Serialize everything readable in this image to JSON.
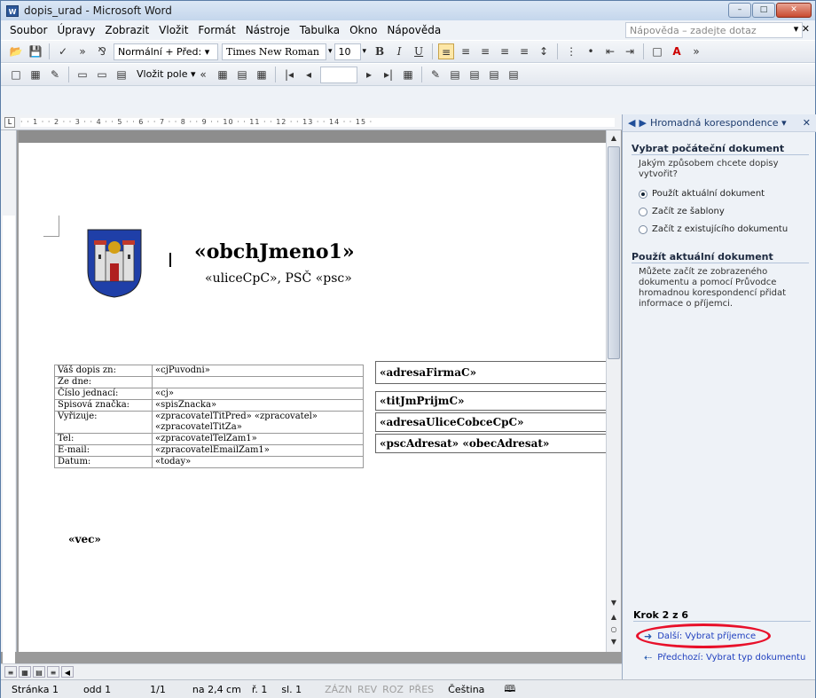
{
  "window": {
    "title": "dopis_urad - Microsoft Word",
    "app_icon": "W",
    "buttons": [
      "–",
      "□",
      "✕"
    ]
  },
  "menu": {
    "items": [
      "Soubor",
      "Úpravy",
      "Zobrazit",
      "Vložit",
      "Formát",
      "Nástroje",
      "Tabulka",
      "Okno",
      "Nápověda"
    ],
    "help_placeholder": "Nápověda – zadejte dotaz",
    "close": "▾ ✕"
  },
  "toolbar1": {
    "style": "Normální + Před: ▾",
    "font": "Times New Roman",
    "font_arrow": "▾",
    "size": "10",
    "size_arrow": "▾",
    "bold": "B",
    "italic": "I",
    "underline": "U"
  },
  "toolbar2": {
    "insert_field": "Vložit pole ▾",
    "nav_first": "|◂",
    "nav_prev": "◂",
    "nav_next": "▸",
    "nav_last": "▸|"
  },
  "document": {
    "company": "«obchJmeno1»",
    "address": "«uliceCpC», PSČ «psc»",
    "info_rows": [
      {
        "k": "Váš dopis zn:",
        "v": "«cjPuvodni»"
      },
      {
        "k": "Ze dne:",
        "v": ""
      },
      {
        "k": "Číslo jednací:",
        "v": "«cj»"
      },
      {
        "k": "Spisová značka:",
        "v": "«spisZnacka»"
      },
      {
        "k": "Vyřizuje:",
        "v": "«zpracovatelTitPred» «zpracovatel»"
      },
      {
        "k": "",
        "v": "«zpracovatelTitZa»"
      },
      {
        "k": "Tel:",
        "v": "«zpracovatelTelZam1»"
      },
      {
        "k": "E-mail:",
        "v": "«zpracovatelEmailZam1»"
      },
      {
        "k": "Datum:",
        "v": "«today»"
      }
    ],
    "recipient": [
      "«adresaFirmaC»",
      "«titJmPrijmC»",
      "«adresaUliceCobceCpC»",
      "«pscAdresat» «obecAdresat»"
    ],
    "subject": "«vec»"
  },
  "ruler": {
    "scale": "· · 1 · · 2 · · 3 · · 4 · · 5 · · 6 · · 7 · · 8 · · 9 · · 10 · · 11 · · 12 · · 13 · · 14 · · 15 ·"
  },
  "task_pane": {
    "title": "Hromadná korespondence ▾",
    "close": "✕",
    "section1": "Vybrat počáteční dokument",
    "question": "Jakým způsobem chcete dopisy vytvořit?",
    "options": [
      "Použít aktuální dokument",
      "Začít ze šablony",
      "Začít z existujícího dokumentu"
    ],
    "selected": 0,
    "section2": "Použít aktuální dokument",
    "desc": "Můžete začít ze zobrazeného dokumentu a pomocí Průvodce hromadnou korespondencí přidat informace o příjemci.",
    "step": "Krok 2 z 6",
    "next": "Další: Vybrat příjemce",
    "prev": "Předchozí: Vybrat typ dokumentu"
  },
  "status": {
    "page": "Stránka 1",
    "section": "odd 1",
    "pages": "1/1",
    "at": "na 2,4 cm",
    "line": "ř. 1",
    "col": "sl. 1",
    "modes": [
      "ZÁZN",
      "REV",
      "ROZ",
      "PŘES"
    ],
    "lang": "Čeština",
    "spell_icon": "🕮"
  },
  "colors": {
    "highlight": "#e8102a",
    "accent": "#2b579a"
  }
}
